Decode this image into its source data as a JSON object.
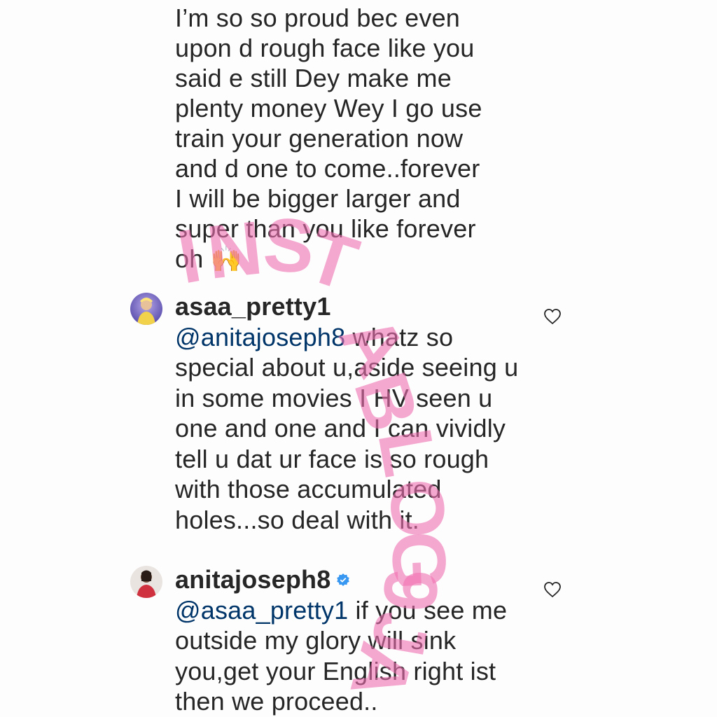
{
  "previous_comment": {
    "text": "I’m so so proud bec even\nupon d rough face like you\nsaid e still Dey make me\nplenty money Wey I go use\ntrain your generation now\nand d one to come..forever\nI will be bigger larger and\nsuper than you like forever\noh 🙌"
  },
  "comments": [
    {
      "username": "asaa_pretty1",
      "verified": false,
      "mention": "@anitajoseph8",
      "text": " whatz so special about u,aside seeing u in some movies I HV seen u one and one and I can vividly tell u dat ur face is so rough with those accumulated holes...so deal with it.",
      "like_icon": "heart-outline-icon"
    },
    {
      "username": "anitajoseph8",
      "verified": true,
      "mention": "@asaa_pretty1",
      "text": " if you see me outside my glory will sink you,get your English right ist then we proceed..",
      "like_icon": "heart-outline-icon"
    }
  ],
  "watermark": {
    "text": "INSTABLOG9JA"
  },
  "colors": {
    "text": "#262626",
    "mention": "#003569",
    "watermark": "#f06fb0",
    "verified": "#3897f0",
    "heart_stroke": "#262626"
  }
}
